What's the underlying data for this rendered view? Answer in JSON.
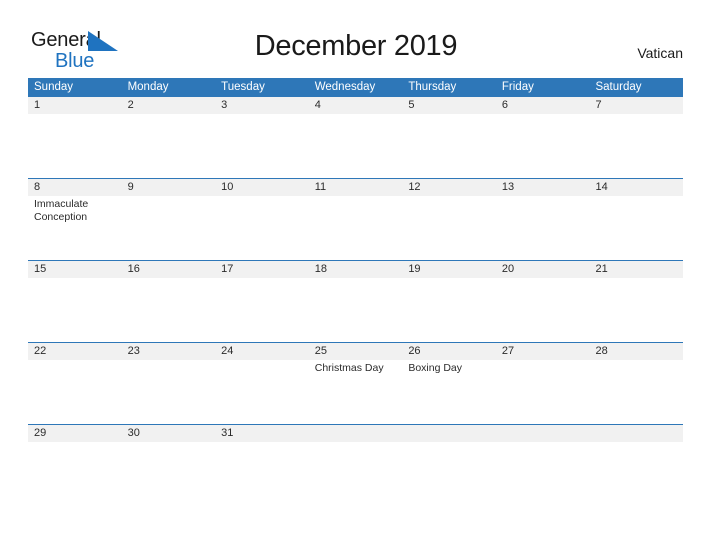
{
  "logo": {
    "word_one": "General",
    "word_two": "Blue",
    "flag_icon": "blue-triangle-flag-icon",
    "flag_color": "#1f73c0"
  },
  "header": {
    "title": "December 2019",
    "region": "Vatican"
  },
  "theme": {
    "header_blue": "#2e77b8",
    "date_band_gray": "#f1f1f1",
    "text_dark": "#2b2b2b",
    "logo_blue": "#1f73c0"
  },
  "calendar": {
    "month": "December",
    "year": "2019",
    "weekday_headers": [
      "Sunday",
      "Monday",
      "Tuesday",
      "Wednesday",
      "Thursday",
      "Friday",
      "Saturday"
    ],
    "weeks": [
      {
        "days": [
          {
            "date": "1",
            "event": ""
          },
          {
            "date": "2",
            "event": ""
          },
          {
            "date": "3",
            "event": ""
          },
          {
            "date": "4",
            "event": ""
          },
          {
            "date": "5",
            "event": ""
          },
          {
            "date": "6",
            "event": ""
          },
          {
            "date": "7",
            "event": ""
          }
        ]
      },
      {
        "days": [
          {
            "date": "8",
            "event": "Immaculate Conception"
          },
          {
            "date": "9",
            "event": ""
          },
          {
            "date": "10",
            "event": ""
          },
          {
            "date": "11",
            "event": ""
          },
          {
            "date": "12",
            "event": ""
          },
          {
            "date": "13",
            "event": ""
          },
          {
            "date": "14",
            "event": ""
          }
        ]
      },
      {
        "days": [
          {
            "date": "15",
            "event": ""
          },
          {
            "date": "16",
            "event": ""
          },
          {
            "date": "17",
            "event": ""
          },
          {
            "date": "18",
            "event": ""
          },
          {
            "date": "19",
            "event": ""
          },
          {
            "date": "20",
            "event": ""
          },
          {
            "date": "21",
            "event": ""
          }
        ]
      },
      {
        "days": [
          {
            "date": "22",
            "event": ""
          },
          {
            "date": "23",
            "event": ""
          },
          {
            "date": "24",
            "event": ""
          },
          {
            "date": "25",
            "event": "Christmas Day"
          },
          {
            "date": "26",
            "event": "Boxing Day"
          },
          {
            "date": "27",
            "event": ""
          },
          {
            "date": "28",
            "event": ""
          }
        ]
      },
      {
        "days": [
          {
            "date": "29",
            "event": ""
          },
          {
            "date": "30",
            "event": ""
          },
          {
            "date": "31",
            "event": ""
          },
          {
            "date": "",
            "event": ""
          },
          {
            "date": "",
            "event": ""
          },
          {
            "date": "",
            "event": ""
          },
          {
            "date": "",
            "event": ""
          }
        ]
      }
    ]
  }
}
